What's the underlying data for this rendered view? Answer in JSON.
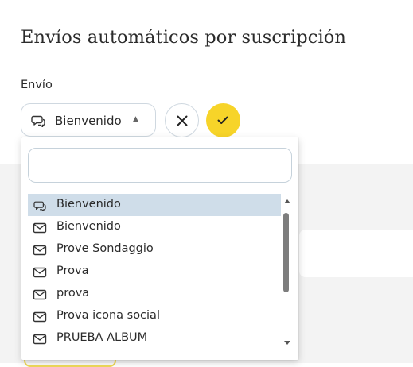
{
  "page": {
    "title": "Envíos automáticos por suscripción"
  },
  "form": {
    "field_label": "Envío",
    "select": {
      "value": "Bienvenido",
      "icon": "chat-bubble-icon"
    },
    "cancel_icon": "close-icon",
    "confirm_icon": "check-icon"
  },
  "dropdown": {
    "search": {
      "value": "",
      "placeholder": ""
    },
    "options": [
      {
        "label": "Bienvenido",
        "icon": "chat-bubble-icon",
        "selected": true
      },
      {
        "label": "Bienvenido",
        "icon": "envelope-icon",
        "selected": false
      },
      {
        "label": "Prove Sondaggio",
        "icon": "envelope-icon",
        "selected": false
      },
      {
        "label": "Prova",
        "icon": "envelope-icon",
        "selected": false
      },
      {
        "label": "prova",
        "icon": "envelope-icon",
        "selected": false
      },
      {
        "label": "Prova icona social",
        "icon": "envelope-icon",
        "selected": false
      },
      {
        "label": "PRUEBA ALBUM",
        "icon": "envelope-icon",
        "selected": false
      }
    ]
  },
  "colors": {
    "accent_yellow": "#f7d429",
    "selected_row": "#cfdde9",
    "border": "#cfd8e0"
  }
}
